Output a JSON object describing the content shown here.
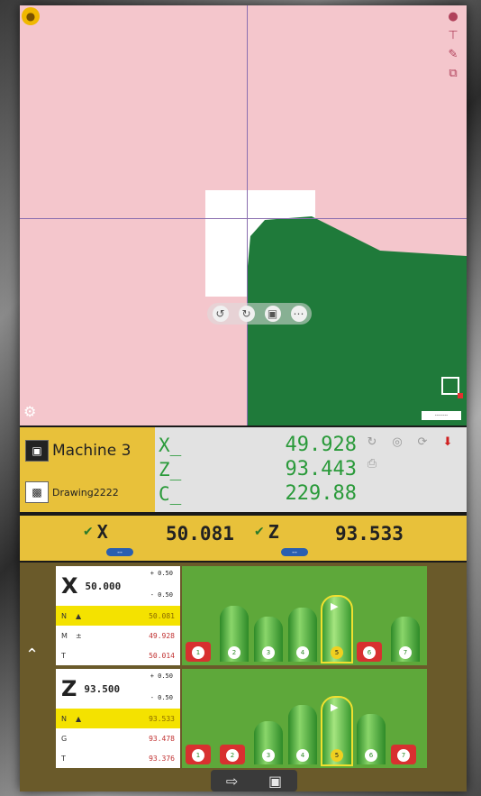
{
  "canvas": {
    "toolbar_icons": [
      "undo-icon",
      "redo-icon",
      "save-icon",
      "more-icon"
    ],
    "right_tools": [
      "light-icon",
      "crosshair-icon",
      "edit-icon",
      "copy-icon"
    ],
    "scale_label": "--------"
  },
  "machine": {
    "name": "Machine 3",
    "drawing": "Drawing2222"
  },
  "position": {
    "axes": [
      {
        "label": "X_",
        "value": "49.928"
      },
      {
        "label": "Z_",
        "value": "93.443"
      },
      {
        "label": "C_",
        "value": "229.88"
      }
    ]
  },
  "offsets": {
    "x_label": "X",
    "x_value": "50.081",
    "z_label": "Z",
    "z_value": "93.533",
    "pill_label": "--"
  },
  "measurements": [
    {
      "axis": "X",
      "nominal": "50.000",
      "tol_plus": "+ 0.50",
      "tol_minus": "- 0.50",
      "rows": [
        {
          "label": "N",
          "mark": "▲",
          "value": "50.081",
          "cls": "hl"
        },
        {
          "label": "M",
          "mark": "±",
          "value": "49.928",
          "cls": "red"
        },
        {
          "label": "T",
          "mark": "",
          "value": "50.014",
          "cls": "red"
        }
      ],
      "badges": [
        "1",
        "2",
        "3",
        "4",
        "5",
        "6",
        "7"
      ],
      "selected": 4
    },
    {
      "axis": "Z",
      "nominal": "93.500",
      "tol_plus": "+ 0.50",
      "tol_minus": "- 0.50",
      "rows": [
        {
          "label": "N",
          "mark": "▲",
          "value": "93.533",
          "cls": "hl"
        },
        {
          "label": "G",
          "mark": "",
          "value": "93.478",
          "cls": "red"
        },
        {
          "label": "T",
          "mark": "",
          "value": "93.376",
          "cls": "red"
        }
      ],
      "badges": [
        "1",
        "2",
        "3",
        "4",
        "5",
        "6",
        "7"
      ],
      "selected": 4
    }
  ],
  "bottom_toolbar": [
    "export-icon",
    "save-icon"
  ],
  "colors": {
    "canvas_bg": "#f4c6cc",
    "part_green": "#1f7a3a",
    "accent_yellow": "#e8c13a",
    "readout_green": "#2a9a3a",
    "alarm_red": "#d83030"
  }
}
